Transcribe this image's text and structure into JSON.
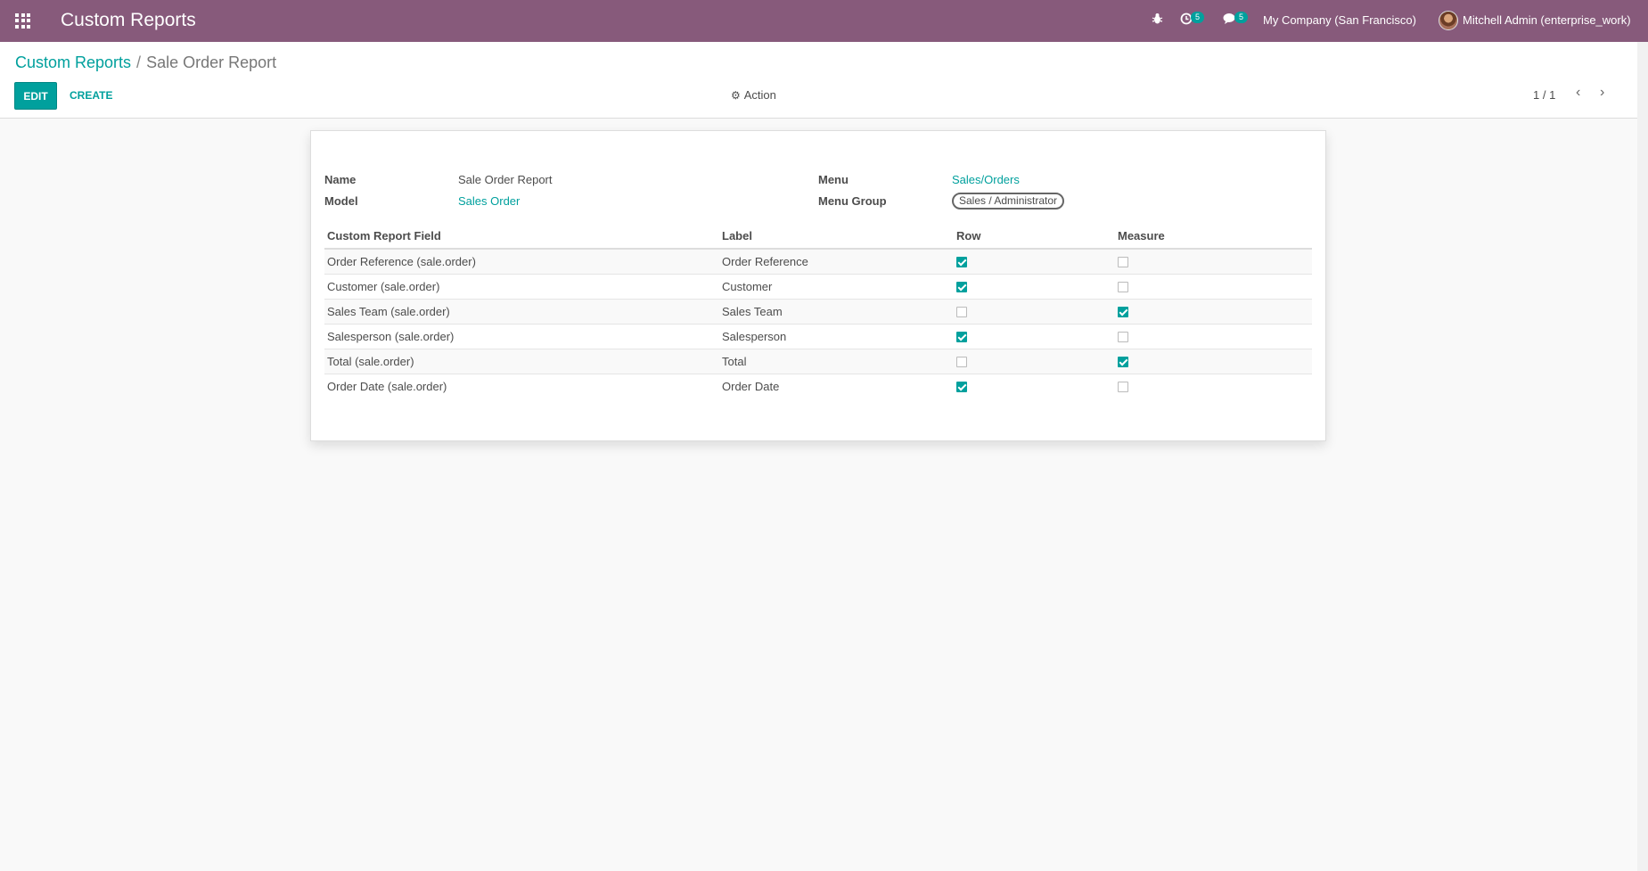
{
  "navbar": {
    "app_title": "Custom Reports",
    "activity_count": "5",
    "messages_count": "5",
    "company": "My Company (San Francisco)",
    "user": "Mitchell Admin (enterprise_work)",
    "bg_color": "#875a7b"
  },
  "breadcrumb": {
    "parent": "Custom Reports",
    "separator": "/",
    "current": "Sale Order Report"
  },
  "toolbar": {
    "edit_label": "EDIT",
    "create_label": "CREATE",
    "action_label": "Action",
    "pager": "1 / 1",
    "accent_color": "#00a09d"
  },
  "form": {
    "name_label": "Name",
    "name_value": "Sale Order Report",
    "model_label": "Model",
    "model_value": "Sales Order",
    "menu_label": "Menu",
    "menu_value": "Sales/Orders",
    "menu_group_label": "Menu Group",
    "menu_group_value": "Sales / Administrator"
  },
  "table": {
    "headers": [
      "Custom Report Field",
      "Label",
      "Row",
      "Measure"
    ],
    "rows": [
      {
        "field": "Order Reference (sale.order)",
        "label": "Order Reference",
        "row": true,
        "measure": false
      },
      {
        "field": "Customer (sale.order)",
        "label": "Customer",
        "row": true,
        "measure": false
      },
      {
        "field": "Sales Team (sale.order)",
        "label": "Sales Team",
        "row": false,
        "measure": true
      },
      {
        "field": "Salesperson (sale.order)",
        "label": "Salesperson",
        "row": true,
        "measure": false
      },
      {
        "field": "Total (sale.order)",
        "label": "Total",
        "row": false,
        "measure": true
      },
      {
        "field": "Order Date (sale.order)",
        "label": "Order Date",
        "row": true,
        "measure": false
      }
    ]
  }
}
